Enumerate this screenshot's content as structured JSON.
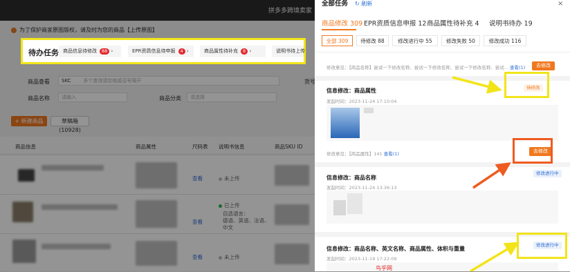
{
  "background_page": {
    "brand": "拼多多跨境卖家",
    "notice": "为了保护商家原图版权，请及时为您的商品【上传原图】",
    "todo": {
      "title": "待办任务",
      "items": [
        {
          "label": "商品信息待修改",
          "count": "88"
        },
        {
          "label": "EPR资质信息待申报",
          "count": "4"
        },
        {
          "label": "商品属性待补充",
          "count": "8"
        },
        {
          "label": "说明书待上传",
          "count": ""
        }
      ]
    },
    "filters": {
      "search_label": "商品查看",
      "search_type": "SKC",
      "search_placeholder": "多个查询请空格或逗号隔开",
      "goods_no_label": "货号",
      "name_label": "商品名称",
      "name_placeholder": "请输入",
      "category_label": "商品分类",
      "category_placeholder": "请选择"
    },
    "buttons": {
      "new_goods": "+ 新建商品",
      "draft": "草稿箱(10928)"
    },
    "table": {
      "headers": [
        "商品信息",
        "商品属性",
        "尺码表",
        "说明书信息",
        "商品SKU ID"
      ],
      "rows": [
        {
          "link": "查看",
          "manual": "未上传",
          "manual_state": "none"
        },
        {
          "link": "查看",
          "manual": "已上传",
          "manual_state": "uploaded",
          "languages_label": "自选语言：",
          "languages": "德语、英语、法语、",
          "languages_2": "中文"
        },
        {
          "link": "查看",
          "manual": "未上传",
          "manual_state": "none"
        }
      ]
    }
  },
  "panel": {
    "title": "全部任务",
    "refresh": "↻ 刷新",
    "close": "×",
    "tabs": [
      {
        "label": "商品修改 309",
        "active": true
      },
      {
        "label": "EPR资质信息申报 12",
        "active": false
      },
      {
        "label": "商品属性待补充 4",
        "active": false
      },
      {
        "label": "说明书待办 19",
        "active": false
      }
    ],
    "subtabs": [
      {
        "label": "全部 309",
        "active": true
      },
      {
        "label": "待修改 88",
        "active": false
      },
      {
        "label": "修改进行中 55",
        "active": false
      },
      {
        "label": "修改失败 50",
        "active": false
      },
      {
        "label": "修改成功 116",
        "active": false
      }
    ],
    "top_item": {
      "opinion": "修改意见：【商品名称】尝试一下修改名称、尝试一下修改名称、尝试一下修改名称、尝试...",
      "view": "查看(1)",
      "button": "去修改"
    },
    "cards": [
      {
        "title": "信息修改：商品属性",
        "time": "发起时间：2023-11-24 17:10:04",
        "status": "待修改",
        "opinion": "修改意见：【商品属性】141",
        "view": "查看(1)",
        "button": "去修改"
      },
      {
        "title": "信息修改：商品名称",
        "time": "发起时间：2023-11-24 13:36:13",
        "status": "修改进行中"
      },
      {
        "title": "信息修改：商品名称、英文名称、商品属性、体积与重量",
        "time": "发起时间：2023-11-19 17:22:09",
        "status": "修改进行中"
      }
    ]
  },
  "watermark": "鸟乎网",
  "colors": {
    "accent": "#f0781e",
    "highlight_yellow": "#f2e419",
    "highlight_orange": "#ee5a1f",
    "link": "#2f6fd3"
  }
}
